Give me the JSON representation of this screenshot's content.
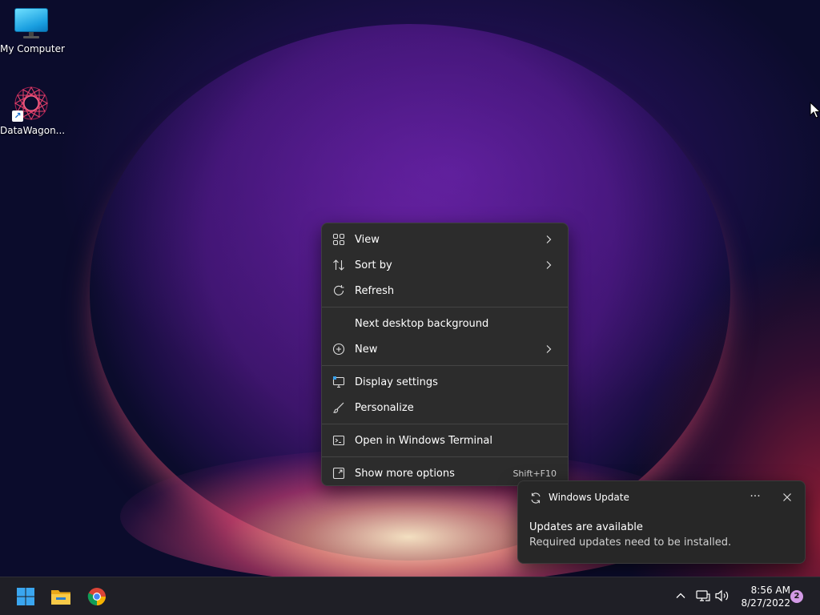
{
  "desktop": {
    "icons": [
      {
        "label": "My Computer",
        "icon": "monitor-icon"
      },
      {
        "label": "DataWagon...",
        "icon": "datawagon-logo-icon"
      }
    ]
  },
  "context_menu": {
    "items": [
      {
        "label": "View",
        "icon": "grid-view-icon",
        "submenu": true
      },
      {
        "label": "Sort by",
        "icon": "sort-icon",
        "submenu": true
      },
      {
        "label": "Refresh",
        "icon": "refresh-icon",
        "submenu": false
      },
      {
        "label": "Next desktop background",
        "icon": "",
        "submenu": false
      },
      {
        "label": "New",
        "icon": "plus-circle-icon",
        "submenu": true
      },
      {
        "label": "Display settings",
        "icon": "display-settings-icon",
        "submenu": false
      },
      {
        "label": "Personalize",
        "icon": "brush-icon",
        "submenu": false
      },
      {
        "label": "Open in Windows Terminal",
        "icon": "terminal-icon",
        "submenu": false
      },
      {
        "label": "Show more options",
        "icon": "more-options-icon",
        "shortcut": "Shift+F10"
      }
    ]
  },
  "notification": {
    "app": "Windows Update",
    "title": "Updates are available",
    "body": "Required updates need to be installed.",
    "more_label": "···"
  },
  "taskbar": {
    "apps": [
      {
        "name": "Start",
        "icon": "windows-start-icon"
      },
      {
        "name": "File Explorer",
        "icon": "folder-icon"
      },
      {
        "name": "Google Chrome",
        "icon": "chrome-icon"
      }
    ],
    "tray": {
      "icons": [
        "chevron-up-icon",
        "network-icon",
        "volume-icon"
      ],
      "time": "8:56 AM",
      "date": "8/27/2022",
      "notification_count": "2"
    }
  },
  "colors": {
    "menu_bg": "#2c2c2c",
    "toast_bg": "#272727",
    "taskbar_bg": "#1f1f26",
    "badge": "#d39ae6",
    "accent": "#1a9fe0"
  }
}
